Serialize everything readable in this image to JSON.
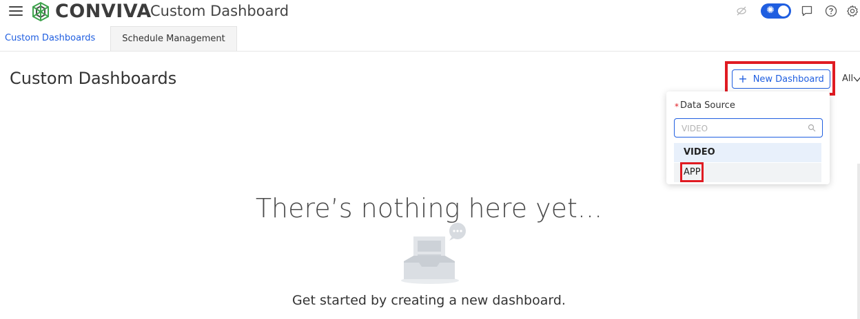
{
  "header": {
    "logo_text": "CONVIVA",
    "app_title": "Custom Dashboard",
    "icons": [
      "menu-icon",
      "visibility-off-icon",
      "theme-toggle",
      "chat-icon",
      "help-icon",
      "settings-icon"
    ]
  },
  "tabs": [
    {
      "label": "Custom Dashboards",
      "active": true
    },
    {
      "label": "Schedule Management",
      "active": false
    }
  ],
  "main": {
    "page_title": "Custom Dashboards",
    "new_dashboard_label": "New Dashboard",
    "filter_label": "All"
  },
  "data_source_popover": {
    "required_mark": "*",
    "label": "Data Source",
    "placeholder": "VIDEO",
    "options": [
      "VIDEO",
      "APP"
    ]
  },
  "empty_state": {
    "title": "There’s nothing here yet...",
    "subtitle": "Get started by creating a new dashboard."
  },
  "colors": {
    "accent": "#1f5ee0",
    "highlight": "#e01b22"
  }
}
